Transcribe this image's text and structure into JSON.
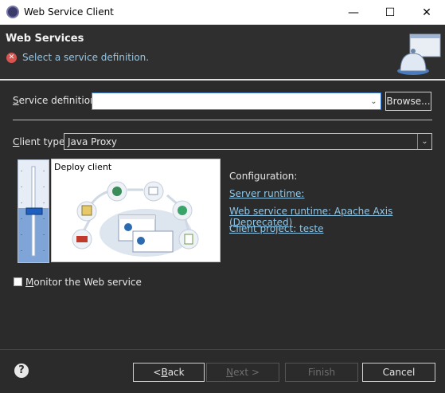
{
  "window": {
    "title": "Web Service Client"
  },
  "header": {
    "title": "Web Services",
    "message": "Select a service definition."
  },
  "form": {
    "service_definition_label_pre": "S",
    "service_definition_label_rest": "ervice definition:",
    "service_definition_value": "",
    "browse_label": "Browse...",
    "client_type_label_pre": "C",
    "client_type_label_rest": "lient type:",
    "client_type_value": "Java Proxy"
  },
  "deploy": {
    "label": "Deploy client",
    "level": "deploy client"
  },
  "configuration": {
    "title": "Configuration:",
    "server_runtime": "Server runtime: ",
    "ws_runtime": "Web service runtime: Apache Axis (Deprecated)",
    "client_project": "Client project: teste"
  },
  "monitor": {
    "label_pre": "M",
    "label_rest": "onitor the Web service",
    "checked": false
  },
  "buttons": {
    "back": "< Back",
    "back_pre": "< ",
    "back_u": "B",
    "back_rest": "ack",
    "next": "Next >",
    "next_u": "N",
    "next_rest": "ext >",
    "finish": "Finish",
    "cancel": "Cancel"
  },
  "colors": {
    "background": "#2b2b2b",
    "link": "#8fc7e8",
    "error": "#d9534f"
  }
}
